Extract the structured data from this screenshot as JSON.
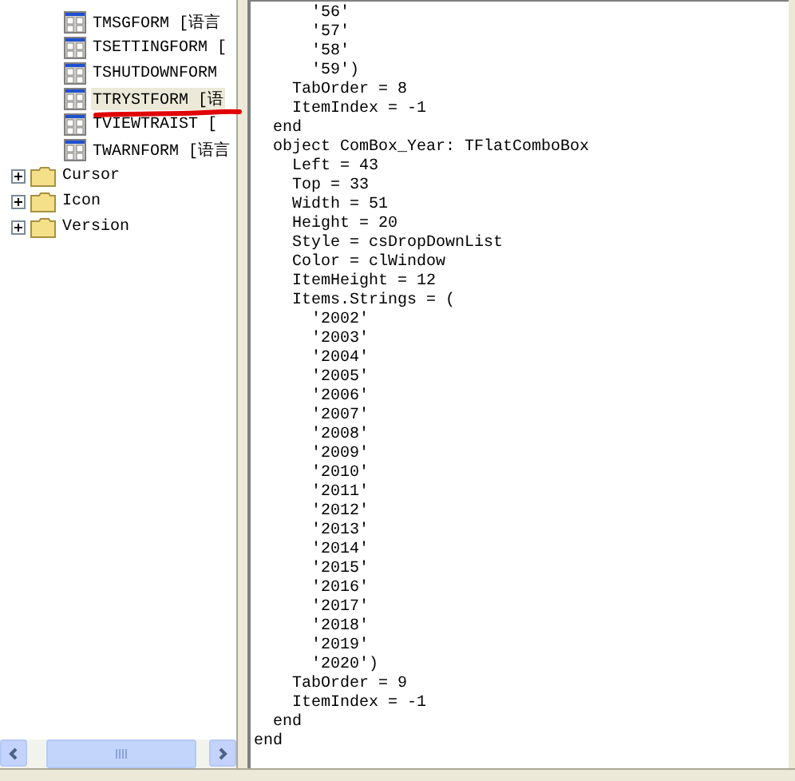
{
  "tree": {
    "forms": [
      {
        "label": "TMSGFORM [语言",
        "selected": false
      },
      {
        "label": "TSETTINGFORM [",
        "selected": false
      },
      {
        "label": "TSHUTDOWNFORM",
        "selected": false
      },
      {
        "label": "TTRYSTFORM [语",
        "selected": true
      },
      {
        "label": "TVIEWTRAIST [",
        "selected": false
      },
      {
        "label": "TWARNFORM [语言",
        "selected": false
      }
    ],
    "folders": [
      {
        "label": "Cursor",
        "expanded": false
      },
      {
        "label": "Icon",
        "expanded": false
      },
      {
        "label": "Version",
        "expanded": false
      }
    ]
  },
  "code": {
    "lines": [
      "      '56'",
      "      '57'",
      "      '58'",
      "      '59')",
      "    TabOrder = 8",
      "    ItemIndex = -1",
      "  end",
      "  object ComBox_Year: TFlatComboBox",
      "    Left = 43",
      "    Top = 33",
      "    Width = 51",
      "    Height = 20",
      "    Style = csDropDownList",
      "    Color = clWindow",
      "    ItemHeight = 12",
      "    Items.Strings = (",
      "      '2002'",
      "      '2003'",
      "      '2004'",
      "      '2005'",
      "      '2006'",
      "      '2007'",
      "      '2008'",
      "      '2009'",
      "      '2010'",
      "      '2011'",
      "      '2012'",
      "      '2013'",
      "      '2014'",
      "      '2015'",
      "      '2016'",
      "      '2017'",
      "      '2018'",
      "      '2019'",
      "      '2020')",
      "    TabOrder = 9",
      "    ItemIndex = -1",
      "  end",
      "end"
    ]
  }
}
